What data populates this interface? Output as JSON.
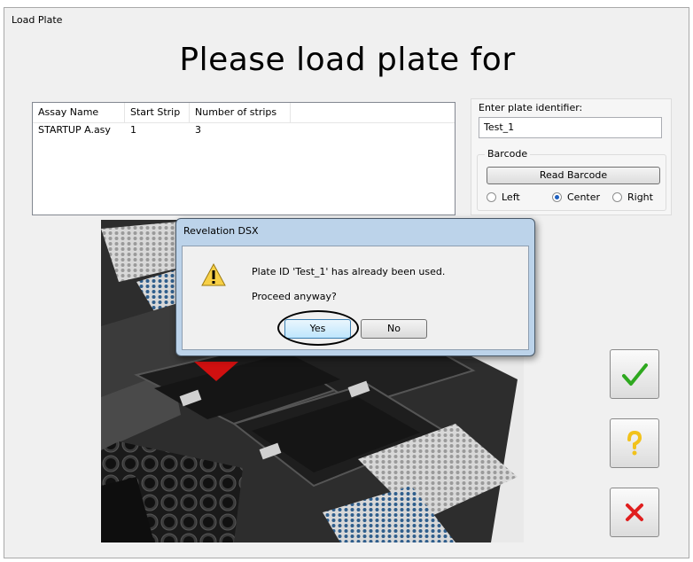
{
  "window": {
    "title": "Load Plate"
  },
  "heading": "Please load plate for",
  "assay_table": {
    "columns": [
      "Assay Name",
      "Start Strip",
      "Number of strips"
    ],
    "rows": [
      [
        "STARTUP A.asy",
        "1",
        "3"
      ]
    ]
  },
  "plate_id": {
    "label": "Enter plate identifier:",
    "value": "Test_1"
  },
  "barcode": {
    "group_label": "Barcode",
    "read_button": "Read Barcode",
    "options": [
      "Left",
      "Center",
      "Right"
    ],
    "selected": "Center"
  },
  "side_buttons": [
    {
      "name": "confirm",
      "icon": "check-icon",
      "color": "#2ea81f"
    },
    {
      "name": "help",
      "icon": "question-icon",
      "color": "#f2c21b"
    },
    {
      "name": "cancel",
      "icon": "close-icon",
      "color": "#e01e1e"
    }
  ],
  "dialog": {
    "title": "Revelation DSX",
    "message": "Plate ID 'Test_1' has already been used.",
    "question": "Proceed anyway?",
    "yes_label": "Yes",
    "no_label": "No",
    "icon": "warning-icon"
  }
}
